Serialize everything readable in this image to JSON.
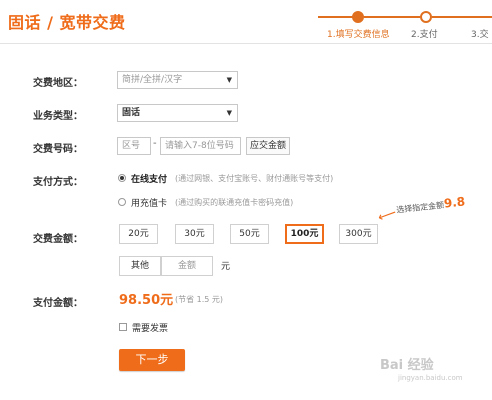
{
  "header": {
    "title": "固话 / 宽带交费",
    "steps": [
      "1.填写交费信息",
      "2.支付",
      "3.交"
    ]
  },
  "form": {
    "region": {
      "label": "交费地区：",
      "placeholder": "简拼/全拼/汉字"
    },
    "business_type": {
      "label": "业务类型：",
      "value": "固话"
    },
    "number": {
      "label": "交费号码：",
      "area_placeholder": "区号",
      "separator": "-",
      "number_placeholder": "请输入7-8位号码",
      "query_button": "应交金额"
    },
    "payment": {
      "label": "支付方式：",
      "options": [
        {
          "name": "在线支付",
          "desc": "(通过网银、支付宝账号、财付通账号等支付)",
          "selected": true
        },
        {
          "name": "用充值卡",
          "desc": "(通过购买的联通充值卡密码充值)",
          "selected": false
        }
      ]
    },
    "amount": {
      "label": "交费金额：",
      "options": [
        "20元",
        "30元",
        "50元",
        "100元",
        "300元"
      ],
      "selected": "100元",
      "other_label": "其他",
      "other_placeholder": "金额",
      "unit": "元"
    },
    "pay_amount": {
      "label": "支付金额：",
      "value": "98.50元",
      "save_note": "(节省 1.5 元)"
    },
    "invoice": {
      "label": "需要发票",
      "checked": false
    },
    "next_button": "下一步"
  },
  "annotation": {
    "text": "选择指定金额",
    "number": "9.8"
  },
  "watermark": {
    "text": "Bai 经验",
    "sub": "jingyan.baidu.com"
  },
  "colors": {
    "accent": "#ef6c1a",
    "border": "#c8c8c8"
  }
}
